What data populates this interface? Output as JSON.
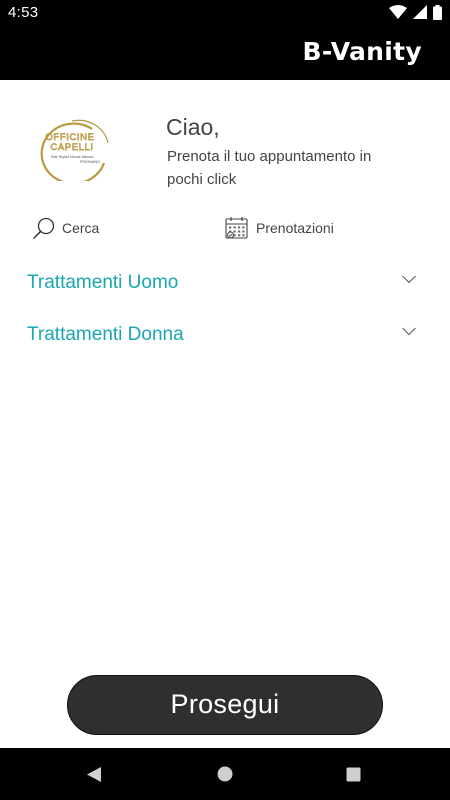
{
  "status_bar": {
    "time": "4:53"
  },
  "app_bar": {
    "brand": "B-Vanity"
  },
  "salon": {
    "logo_lines": [
      "OFFICINE",
      "CAPELLI",
      "Hair Stylist Nicola Merola",
      "FRIGNANO"
    ],
    "logo_color": "#b8983f"
  },
  "header": {
    "greeting": "Ciao,",
    "subtitle": "Prenota il tuo appuntamento in pochi click"
  },
  "actions": {
    "search": {
      "label": "Cerca",
      "icon": "search-icon"
    },
    "bookings": {
      "label": "Prenotazioni",
      "icon": "calendar-icon"
    }
  },
  "categories": [
    {
      "label": "Trattamenti Uomo",
      "icon": "chevron-down-icon"
    },
    {
      "label": "Trattamenti Donna",
      "icon": "chevron-down-icon"
    }
  ],
  "continue_button": {
    "label": "Prosegui"
  },
  "colors": {
    "accent": "#1aa7b3",
    "button": "#2f2f2f",
    "bars": "#000000"
  }
}
